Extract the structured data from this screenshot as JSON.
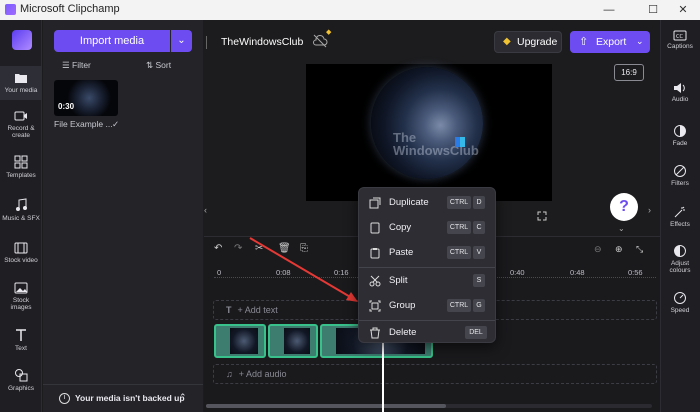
{
  "window": {
    "title": "Microsoft Clipchamp",
    "min": "—",
    "max": "☐",
    "close": "✕"
  },
  "leftnav": {
    "items": [
      {
        "label": "Your media",
        "icon": "folder-icon"
      },
      {
        "label": "Record &",
        "label2": "create",
        "icon": "camera-icon"
      },
      {
        "label": "Templates",
        "icon": "templates-icon"
      },
      {
        "label": "Music & SFX",
        "icon": "music-icon"
      },
      {
        "label": "Stock video",
        "icon": "film-icon"
      },
      {
        "label": "Stock",
        "label2": "images",
        "icon": "image-icon"
      },
      {
        "label": "Text",
        "icon": "text-icon"
      },
      {
        "label": "Graphics",
        "icon": "graphics-icon"
      }
    ]
  },
  "media": {
    "import_label": "Import media",
    "filter_label": "Filter",
    "sort_label": "Sort",
    "item": {
      "duration": "0:30",
      "name": "File Example ..."
    },
    "backup_text": "Your media isn't backed up"
  },
  "project": {
    "name": "TheWindowsClub",
    "upgrade_label": "Upgrade",
    "export_label": "Export",
    "aspect": "16:9"
  },
  "rightpanel": {
    "items": [
      {
        "label": "Captions",
        "icon": "captions-icon"
      },
      {
        "label": "Audio",
        "icon": "audio-icon"
      },
      {
        "label": "Fade",
        "icon": "fade-icon"
      },
      {
        "label": "Filters",
        "icon": "filters-icon"
      },
      {
        "label": "Effects",
        "icon": "effects-icon"
      },
      {
        "label": "Adjust",
        "label2": "colours",
        "icon": "adjust-colours-icon"
      },
      {
        "label": "Speed",
        "icon": "speed-icon"
      }
    ]
  },
  "timeline": {
    "ruler": [
      "0",
      "0:08",
      "0:16",
      "0:40",
      "0:48",
      "0:56"
    ],
    "add_text": "+ Add text",
    "add_audio": "+ Add audio"
  },
  "context_menu": {
    "items": [
      {
        "label": "Duplicate",
        "keys": [
          "CTRL",
          "D"
        ]
      },
      {
        "label": "Copy",
        "keys": [
          "CTRL",
          "C"
        ]
      },
      {
        "label": "Paste",
        "keys": [
          "CTRL",
          "V"
        ]
      },
      {
        "label": "Split",
        "keys": [
          "S"
        ]
      },
      {
        "label": "Group",
        "keys": [
          "CTRL",
          "G"
        ]
      },
      {
        "label": "Delete",
        "keys": [
          "DEL"
        ]
      }
    ]
  },
  "help": {
    "label": "?"
  },
  "watermark": {
    "line1": "The",
    "line2": "WindowsClub"
  },
  "colors": {
    "accent": "#6d4df2",
    "clip_border": "#38c18a",
    "arrow": "#e53935"
  }
}
